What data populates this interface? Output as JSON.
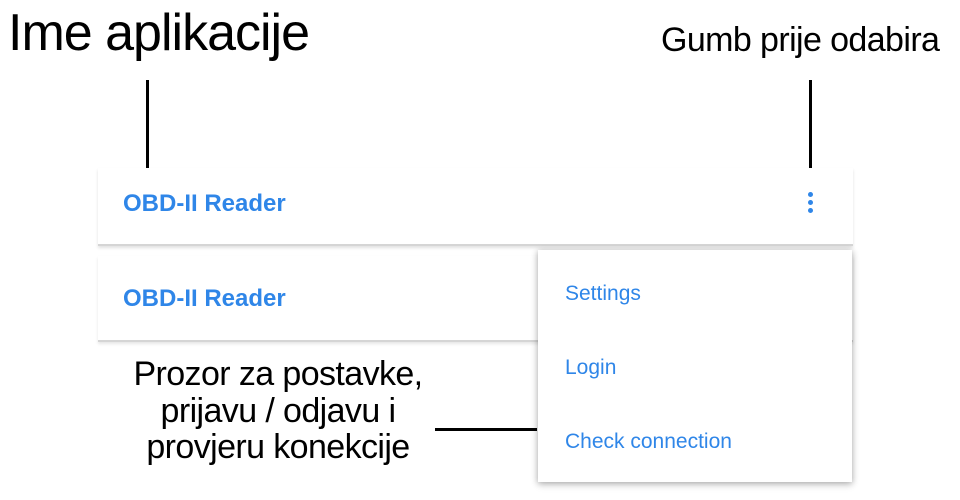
{
  "annotations": {
    "app_name": "Ime aplikacije",
    "overflow_button": "Gumb prije odabira",
    "menu_window": [
      "Prozor za postavke,",
      "prijavu / odjavu i",
      "provjeru konekcije"
    ]
  },
  "appbar_collapsed": {
    "title": "OBD-II Reader",
    "overflow_icon": "more-vert-icon"
  },
  "appbar_expanded": {
    "title": "OBD-II Reader"
  },
  "overflow_menu": {
    "items": [
      {
        "label": "Settings"
      },
      {
        "label": "Login"
      },
      {
        "label": "Check connection"
      }
    ]
  },
  "colors": {
    "accent": "#2f86e8",
    "divider": "#d5d5d5",
    "annotation_text": "#000000"
  }
}
